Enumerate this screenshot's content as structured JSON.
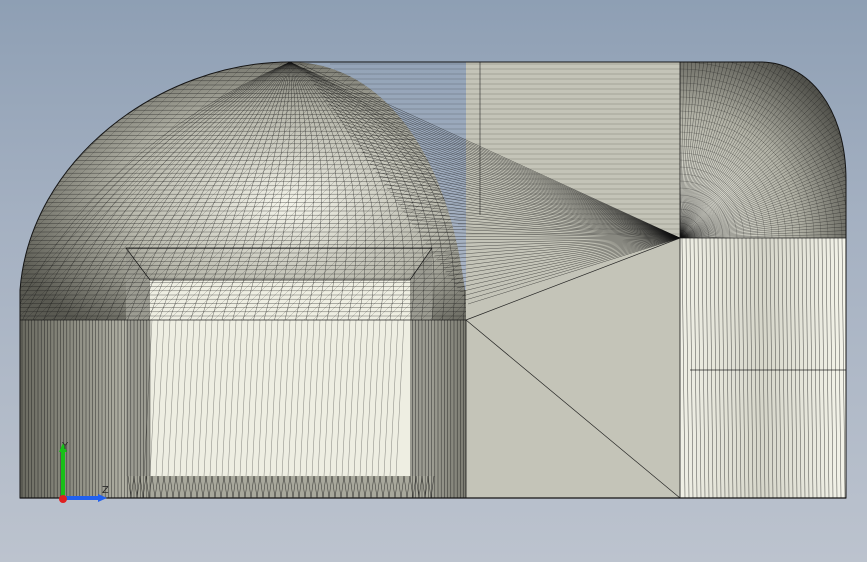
{
  "viewport": {
    "background_top": "#8e9fb4",
    "background_bottom": "#bcc3ce"
  },
  "model": {
    "shaded_face_color": "#c4c4b8",
    "light_face_color": "#eeeee2",
    "edge_color": "#141414"
  },
  "triad": {
    "x_label": "",
    "y_label": "Y",
    "z_label": "Z",
    "x_color": "#e02020",
    "y_color": "#18c018",
    "z_color": "#2060f0"
  }
}
